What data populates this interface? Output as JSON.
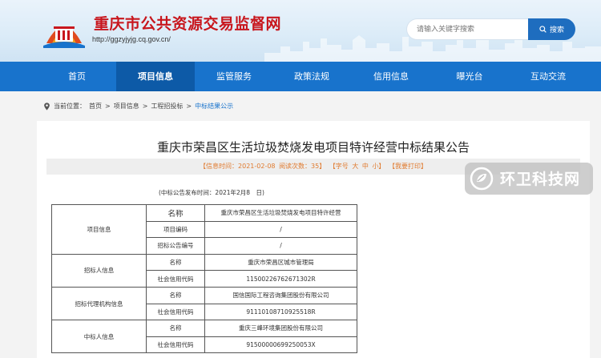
{
  "header": {
    "site_title": "重庆市公共资源交易监督网",
    "site_url": "http://ggzyjyjg.cq.gov.cn/",
    "search_placeholder": "请输入关键字搜索",
    "search_button": "搜索"
  },
  "nav": {
    "items": [
      {
        "label": "首页"
      },
      {
        "label": "项目信息"
      },
      {
        "label": "监管服务"
      },
      {
        "label": "政策法规"
      },
      {
        "label": "信用信息"
      },
      {
        "label": "曝光台"
      },
      {
        "label": "互动交流"
      }
    ],
    "active_index": 1
  },
  "breadcrumb": {
    "prefix": "当前位置：",
    "items": [
      "首页",
      "项目信息",
      "工程招投标",
      "中标结果公示"
    ],
    "separator": ">"
  },
  "article": {
    "title": "重庆市荣昌区生活垃圾焚烧发电项目特许经营中标结果公告",
    "meta": {
      "info_time": "【信息时间：2021-02-08",
      "views": "阅读次数：35】",
      "font_size_label": "【字号",
      "font_large": "大",
      "font_medium": "中",
      "font_small": "小】",
      "print": "【我要打印】"
    },
    "pub_date": "(中标公告发布时间：2021年2月8　日)",
    "table": {
      "header_label": "名称",
      "header_value": "重庆市荣昌区生活垃圾焚烧发电项目特许经营",
      "project_group": "项目信息",
      "project_code_label": "项目编码",
      "project_code_value": "/",
      "notice_no_label": "招标公告编号",
      "notice_no_value": "/",
      "tenderer_group": "招标人信息",
      "tenderer_name_label": "名称",
      "tenderer_name_value": "重庆市荣昌区城市管理局",
      "tenderer_code_label": "社会信用代码",
      "tenderer_code_value": "11500226762671302R",
      "agency_group": "招标代理机构信息",
      "agency_name_label": "名称",
      "agency_name_value": "国信国际工程咨询集团股份有限公司",
      "agency_code_label": "社会信用代码",
      "agency_code_value": "91110108710925518R",
      "winner_group": "中标人信息",
      "winner_name_label": "名称",
      "winner_name_value": "重庆三峰环境集团股份有限公司",
      "winner_code_label": "社会信用代码",
      "winner_code_value": "91500000699250053X"
    }
  },
  "watermark": {
    "text": "环卫科技网"
  }
}
